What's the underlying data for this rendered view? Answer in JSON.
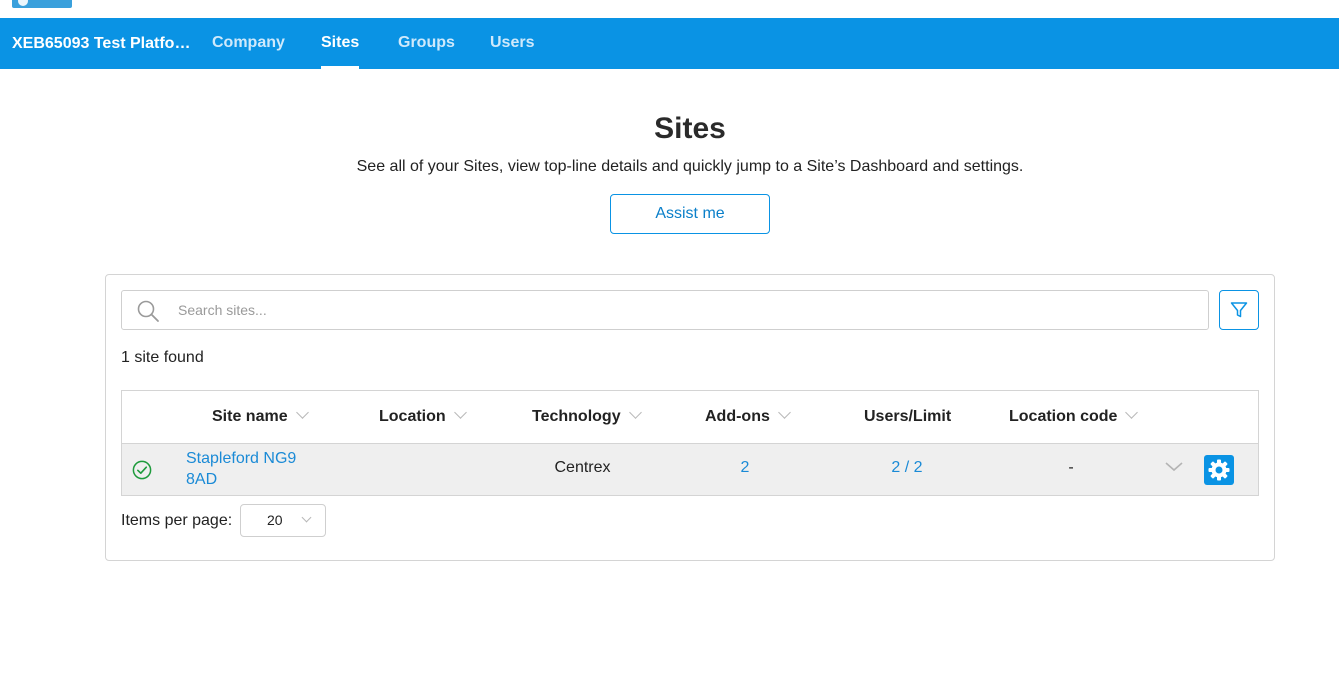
{
  "header": {
    "company_name": "XEB65093 Test Platfo…",
    "tabs": [
      {
        "label": "Company"
      },
      {
        "label": "Sites"
      },
      {
        "label": "Groups"
      },
      {
        "label": "Users"
      }
    ],
    "active_tab": "Sites"
  },
  "page": {
    "title": "Sites",
    "subtitle": "See all of your Sites, view top-line details and quickly jump to a Site’s Dashboard and settings.",
    "assist_label": "Assist me"
  },
  "search": {
    "placeholder": "Search sites...",
    "value": ""
  },
  "results_count": "1 site found",
  "table": {
    "columns": [
      "Site name",
      "Location",
      "Technology",
      "Add-ons",
      "Users/Limit",
      "Location code"
    ],
    "rows": [
      {
        "site_name": "Stapleford NG9 8AD",
        "location": "",
        "technology": "Centrex",
        "addons": "2",
        "users_limit": "2 / 2",
        "location_code": "-",
        "status": "active"
      }
    ]
  },
  "pagination": {
    "items_per_page_label": "Items per page:",
    "items_per_page_value": "20"
  },
  "colors": {
    "brand_blue": "#0a93e4",
    "link_blue": "#1a8ad6",
    "status_green": "#1e9b3c"
  },
  "icons": [
    "search-icon",
    "filter-icon",
    "check-circle-icon",
    "chevron-down-icon",
    "gear-icon"
  ]
}
